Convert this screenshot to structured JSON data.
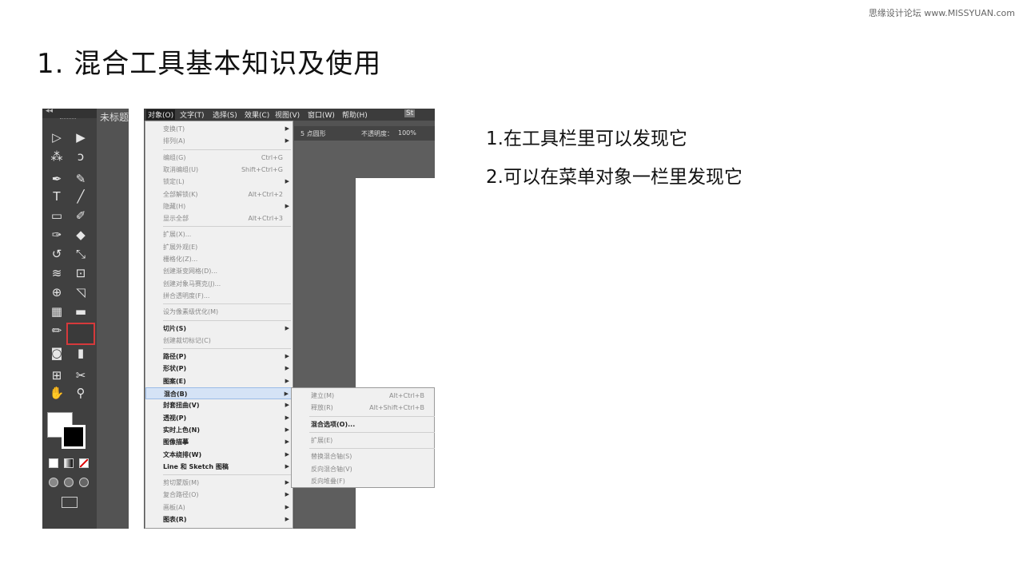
{
  "watermark": "思缘设计论坛 www.MISSYUAN.com",
  "title": "1.  混合工具基本知识及使用",
  "notes": [
    "1.在工具栏里可以发现它",
    "2.可以在菜单对象一栏里发现它"
  ],
  "toolbar": {
    "collapse": "◂◂",
    "doc_tab": "未标题",
    "tools": [
      {
        "name": "selection-tool-icon",
        "g": "▷"
      },
      {
        "name": "direct-selection-tool-icon",
        "g": "▶"
      },
      {
        "name": "magic-wand-tool-icon",
        "g": "⁂"
      },
      {
        "name": "lasso-tool-icon",
        "g": "ↄ"
      },
      {
        "name": "pen-tool-icon",
        "g": "✒"
      },
      {
        "name": "curvature-tool-icon",
        "g": "✎"
      },
      {
        "name": "type-tool-icon",
        "g": "T"
      },
      {
        "name": "line-tool-icon",
        "g": "╱"
      },
      {
        "name": "rectangle-tool-icon",
        "g": "▭"
      },
      {
        "name": "paintbrush-tool-icon",
        "g": "✐"
      },
      {
        "name": "shaper-tool-icon",
        "g": "✑"
      },
      {
        "name": "eraser-tool-icon",
        "g": "◆"
      },
      {
        "name": "rotate-tool-icon",
        "g": "↺"
      },
      {
        "name": "scale-tool-icon",
        "g": "⤡"
      },
      {
        "name": "width-tool-icon",
        "g": "≋"
      },
      {
        "name": "free-transform-tool-icon",
        "g": "⊡"
      },
      {
        "name": "shape-builder-tool-icon",
        "g": "⊕"
      },
      {
        "name": "perspective-grid-tool-icon",
        "g": "◹"
      },
      {
        "name": "mesh-tool-icon",
        "g": "▦"
      },
      {
        "name": "gradient-tool-icon",
        "g": "▬"
      },
      {
        "name": "eyedropper-tool-icon",
        "g": "✏"
      },
      {
        "name": "blend-tool-icon",
        "g": "◐"
      },
      {
        "name": "symbol-sprayer-tool-icon",
        "g": "◙"
      },
      {
        "name": "column-graph-tool-icon",
        "g": "▮"
      },
      {
        "name": "artboard-tool-icon",
        "g": "⊞"
      },
      {
        "name": "slice-tool-icon",
        "g": "✂"
      },
      {
        "name": "hand-tool-icon",
        "g": "✋"
      },
      {
        "name": "zoom-tool-icon",
        "g": "⚲"
      }
    ]
  },
  "menubar": [
    "对象(O)",
    "文字(T)",
    "选择(S)",
    "效果(C)",
    "视图(V)",
    "窗口(W)",
    "帮助(H)"
  ],
  "menubar_extra": "St",
  "controlbar": {
    "brush": "5 点圆形",
    "opacity_label": "不透明度：",
    "opacity": "100%"
  },
  "menu": [
    {
      "label": "变换(T)",
      "arrow": true,
      "dis": true
    },
    {
      "label": "排列(A)",
      "arrow": true,
      "dis": true
    },
    {
      "sep": true
    },
    {
      "label": "编组(G)",
      "sc": "Ctrl+G",
      "dis": true
    },
    {
      "label": "取消编组(U)",
      "sc": "Shift+Ctrl+G",
      "dis": true
    },
    {
      "label": "锁定(L)",
      "arrow": true,
      "dis": true
    },
    {
      "label": "全部解锁(K)",
      "sc": "Alt+Ctrl+2",
      "dis": true
    },
    {
      "label": "隐藏(H)",
      "arrow": true,
      "dis": true
    },
    {
      "label": "显示全部",
      "sc": "Alt+Ctrl+3",
      "dis": true
    },
    {
      "sep": true
    },
    {
      "label": "扩展(X)...",
      "dis": true
    },
    {
      "label": "扩展外观(E)",
      "dis": true
    },
    {
      "label": "栅格化(Z)...",
      "dis": true
    },
    {
      "label": "创建渐变网格(D)...",
      "dis": true
    },
    {
      "label": "创建对象马赛克(J)...",
      "dis": true
    },
    {
      "label": "拼合透明度(F)...",
      "dis": true
    },
    {
      "sep": true
    },
    {
      "label": "设为像素级优化(M)",
      "dis": true
    },
    {
      "sep": true
    },
    {
      "label": "切片(S)",
      "arrow": true,
      "bold": true
    },
    {
      "label": "创建裁切标记(C)",
      "dis": true
    },
    {
      "sep": true
    },
    {
      "label": "路径(P)",
      "arrow": true,
      "bold": true
    },
    {
      "label": "形状(P)",
      "arrow": true,
      "bold": true
    },
    {
      "label": "图案(E)",
      "arrow": true,
      "bold": true
    },
    {
      "label": "混合(B)",
      "arrow": true,
      "bold": true,
      "sel": true
    },
    {
      "label": "封套扭曲(V)",
      "arrow": true,
      "bold": true
    },
    {
      "label": "透视(P)",
      "arrow": true,
      "bold": true
    },
    {
      "label": "实时上色(N)",
      "arrow": true,
      "bold": true
    },
    {
      "label": "图像描摹",
      "arrow": true,
      "bold": true
    },
    {
      "label": "文本绕排(W)",
      "arrow": true,
      "bold": true
    },
    {
      "label": "Line 和 Sketch 图稿",
      "arrow": true,
      "bold": true
    },
    {
      "sep": true
    },
    {
      "label": "剪切蒙版(M)",
      "arrow": true,
      "dis": true
    },
    {
      "label": "复合路径(O)",
      "arrow": true,
      "dis": true
    },
    {
      "label": "画板(A)",
      "arrow": true,
      "dis": true
    },
    {
      "label": "图表(R)",
      "arrow": true,
      "bold": true
    }
  ],
  "submenu": [
    {
      "label": "建立(M)",
      "sc": "Alt+Ctrl+B",
      "dis": true
    },
    {
      "label": "释放(R)",
      "sc": "Alt+Shift+Ctrl+B",
      "dis": true
    },
    {
      "sep": true
    },
    {
      "label": "混合选项(O)...",
      "bold": true
    },
    {
      "sep": true
    },
    {
      "label": "扩展(E)",
      "dis": true
    },
    {
      "sep": true
    },
    {
      "label": "替换混合轴(S)",
      "dis": true
    },
    {
      "label": "反向混合轴(V)",
      "dis": true
    },
    {
      "label": "反向堆叠(F)",
      "dis": true
    }
  ]
}
